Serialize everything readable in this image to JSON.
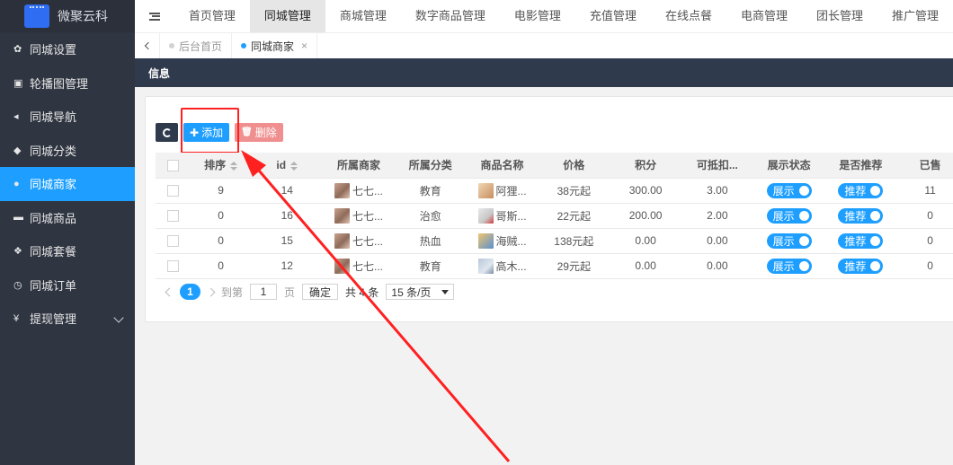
{
  "brand": {
    "name": "微聚云科"
  },
  "sidebar": {
    "items": [
      {
        "label": "同城设置",
        "icon": "gear-icon",
        "glyph": "✿"
      },
      {
        "label": "轮播图管理",
        "icon": "image-icon",
        "glyph": "▣"
      },
      {
        "label": "同城导航",
        "icon": "share-icon",
        "glyph": "◂"
      },
      {
        "label": "同城分类",
        "icon": "tag-icon",
        "glyph": "◆"
      },
      {
        "label": "同城商家",
        "icon": "location-pin-icon",
        "glyph": "●",
        "active": true
      },
      {
        "label": "同城商品",
        "icon": "cart-icon",
        "glyph": "▬"
      },
      {
        "label": "同城套餐",
        "icon": "cubes-icon",
        "glyph": "❖"
      },
      {
        "label": "同城订单",
        "icon": "clock-icon",
        "glyph": "◷"
      },
      {
        "label": "提现管理",
        "icon": "yen-icon",
        "glyph": "¥"
      }
    ]
  },
  "topnav": {
    "items": [
      "首页管理",
      "同城管理",
      "商城管理",
      "数字商品管理",
      "电影管理",
      "充值管理",
      "在线点餐",
      "电商管理",
      "团长管理",
      "推广管理"
    ],
    "active_index": 1
  },
  "tabs": [
    {
      "label": "后台首页"
    },
    {
      "label": "同城商家",
      "close": "×"
    }
  ],
  "infobar": {
    "title": "信息"
  },
  "toolbar": {
    "add_label": "添加",
    "add_glyph": "✚",
    "delete_label": "删除",
    "delete_glyph": "🗑"
  },
  "table": {
    "headers": [
      "排序",
      "id",
      "所属商家",
      "所属分类",
      "商品名称",
      "价格",
      "积分",
      "可抵扣...",
      "展示状态",
      "是否推荐",
      "已售"
    ],
    "rows": [
      {
        "sort": "9",
        "id": "14",
        "merchant": "七七...",
        "category": "教育",
        "product": "阿狸...",
        "price": "38元起",
        "points": "300.00",
        "deduct": "3.00",
        "show": "展示",
        "recommend": "推荐",
        "sold": "11"
      },
      {
        "sort": "0",
        "id": "16",
        "merchant": "七七...",
        "category": "治愈",
        "product": "哥斯...",
        "price": "22元起",
        "points": "200.00",
        "deduct": "2.00",
        "show": "展示",
        "recommend": "推荐",
        "sold": "0"
      },
      {
        "sort": "0",
        "id": "15",
        "merchant": "七七...",
        "category": "热血",
        "product": "海贼...",
        "price": "138元起",
        "points": "0.00",
        "deduct": "0.00",
        "show": "展示",
        "recommend": "推荐",
        "sold": "0"
      },
      {
        "sort": "0",
        "id": "12",
        "merchant": "七七...",
        "category": "教育",
        "product": "高木...",
        "price": "29元起",
        "points": "0.00",
        "deduct": "0.00",
        "show": "展示",
        "recommend": "推荐",
        "sold": "0"
      }
    ]
  },
  "pager": {
    "current": "1",
    "goto_prefix": "到第",
    "goto_value": "1",
    "page_suffix": "页",
    "confirm": "确定",
    "total": "共 4 条",
    "per_page": "15 条/页"
  },
  "colors": {
    "accent": "#1e9fff",
    "sidebar_bg": "#2f3541",
    "annotation": "#ff2020"
  }
}
